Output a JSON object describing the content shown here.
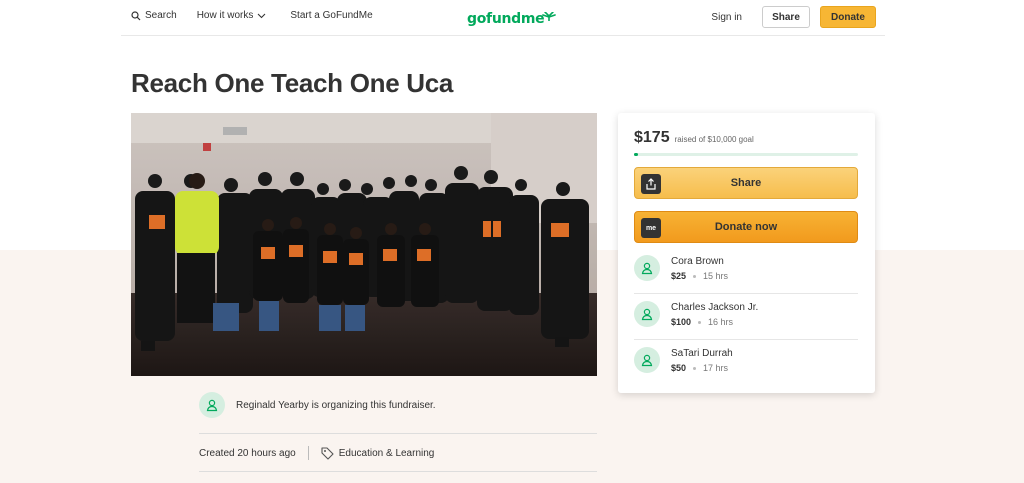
{
  "header": {
    "search_label": "Search",
    "how_label": "How it works",
    "start_label": "Start a GoFundMe",
    "logo_text": "gofundme",
    "signin_label": "Sign in",
    "share_label": "Share",
    "donate_label": "Donate"
  },
  "campaign": {
    "title": "Reach One Teach One Uca",
    "organizer_text": "Reginald Yearby is organizing this fundraiser.",
    "created": "Created 20 hours ago",
    "category": "Education & Learning"
  },
  "progress": {
    "raised": "$175",
    "goal_text": "raised of $10,000 goal",
    "fraction": 0.0175
  },
  "card": {
    "share_label": "Share",
    "donate_label": "Donate now",
    "donate_icon_text": "me"
  },
  "donors": [
    {
      "name": "Cora Brown",
      "amount": "$25",
      "time": "15 hrs"
    },
    {
      "name": "Charles Jackson Jr.",
      "amount": "$100",
      "time": "16 hrs"
    },
    {
      "name": "SaTari Durrah",
      "amount": "$50",
      "time": "17 hrs"
    }
  ],
  "colors": {
    "brand_green": "#02a95c",
    "donate_yellow": "#f7b634"
  }
}
